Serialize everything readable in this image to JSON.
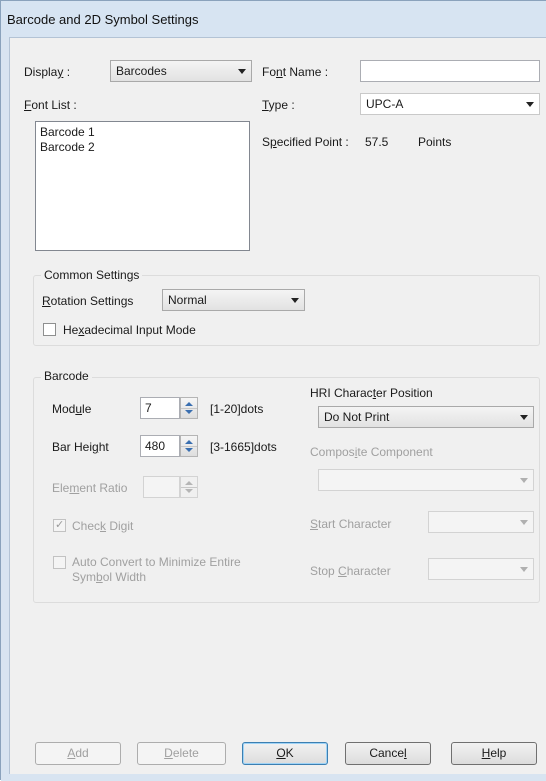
{
  "window": {
    "title": "Barcode and 2D Symbol Settings"
  },
  "display": {
    "label": "Display :",
    "value": "Barcodes"
  },
  "font_list": {
    "label": "Font List :",
    "items": [
      "Barcode 1",
      "Barcode 2"
    ]
  },
  "font_name": {
    "label": "Font Name :",
    "value": ""
  },
  "type": {
    "label": "Type :",
    "value": "UPC-A"
  },
  "specified_point": {
    "label": "Specified Point :",
    "value": "57.5",
    "unit": "Points"
  },
  "common_settings": {
    "caption": "Common Settings",
    "rotation_label": "Rotation Settings",
    "rotation_value": "Normal",
    "hex_label": "Hexadecimal Input Mode",
    "hex_checked": false
  },
  "barcode": {
    "caption": "Barcode",
    "module_label": "Module",
    "module_value": "7",
    "module_range": "[1-20]dots",
    "bar_height_label": "Bar Height",
    "bar_height_value": "480",
    "bar_height_range": "[3-1665]dots",
    "element_ratio_label": "Element Ratio",
    "element_ratio_value": "",
    "check_digit_label": "Check Digit",
    "check_digit_checked": true,
    "auto_convert_label_1": "Auto Convert to Minimize Entire",
    "auto_convert_label_2": "Symbol Width",
    "hri_label": "HRI Character Position",
    "hri_value": "Do Not Print",
    "composite_label": "Composite Component",
    "composite_value": "",
    "start_char_label": "Start Character",
    "start_char_value": "",
    "stop_char_label": "Stop Character",
    "stop_char_value": ""
  },
  "buttons": {
    "add": "Add",
    "delete": "Delete",
    "ok": "OK",
    "cancel": "Cancel",
    "help": "Help"
  }
}
